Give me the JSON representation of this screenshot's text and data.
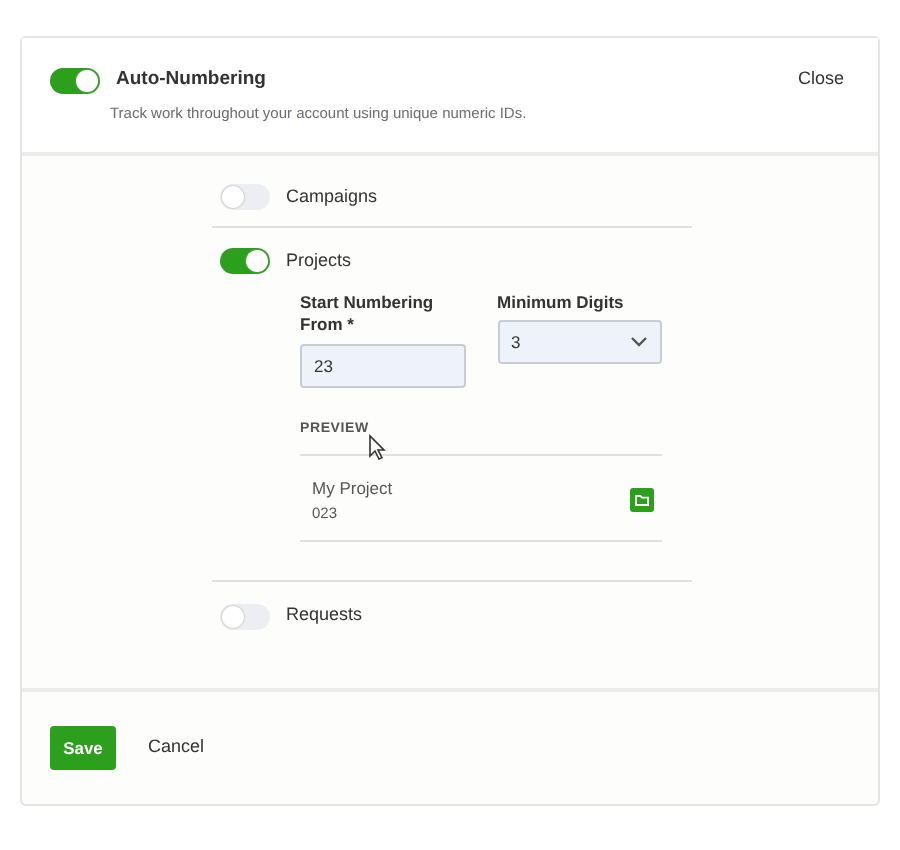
{
  "header": {
    "title": "Auto-Numbering",
    "on": true,
    "description": "Track work throughout your account using unique numeric IDs.",
    "close": "Close"
  },
  "modules": [
    {
      "name": "Campaigns",
      "on": false
    },
    {
      "name": "Projects",
      "on": true,
      "start_label": "Start Numbering From *",
      "start_value": "23",
      "digits_label": "Minimum Digits",
      "digits_value": "3",
      "preview_label": "PREVIEW",
      "preview_name": "My Project",
      "preview_number": "023"
    },
    {
      "name": "Requests",
      "on": false
    }
  ],
  "footer": {
    "save": "Save",
    "cancel": "Cancel"
  }
}
